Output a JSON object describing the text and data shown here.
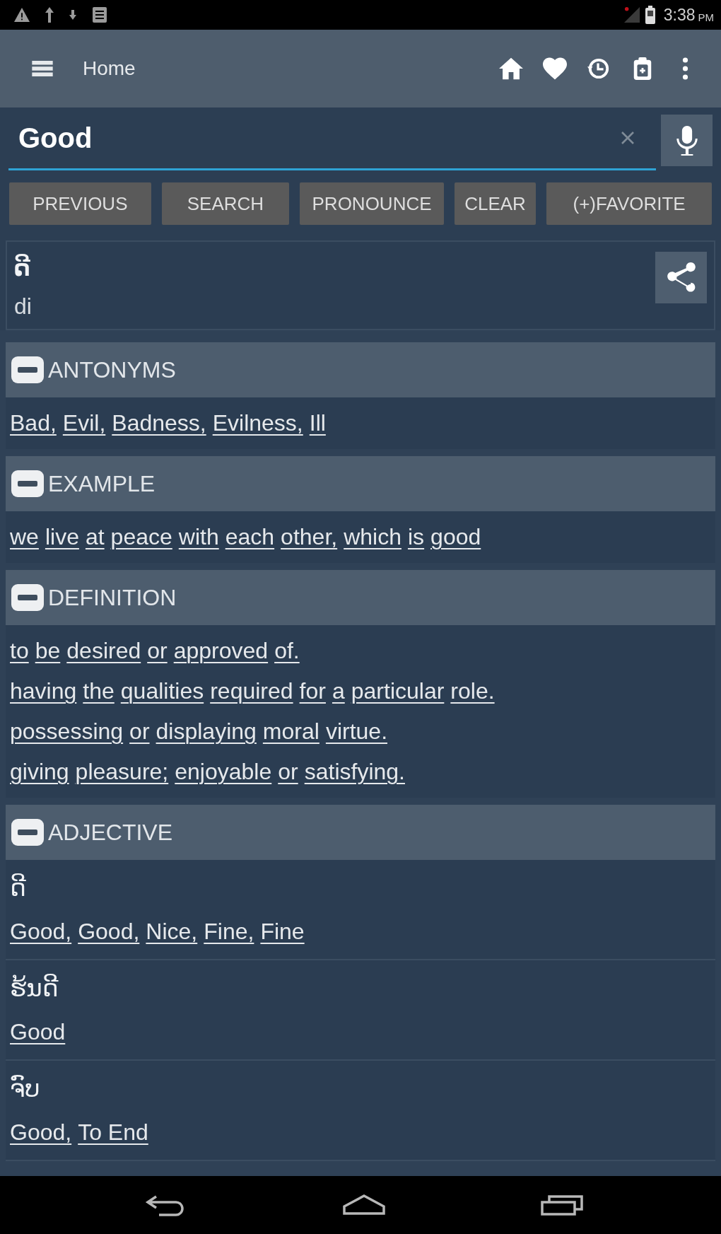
{
  "status_bar": {
    "time": "3:38",
    "period": "PM"
  },
  "app_bar": {
    "title": "Home"
  },
  "search": {
    "value": "Good"
  },
  "buttons": [
    "PREVIOUS",
    "SEARCH",
    "PRONOUNCE",
    "CLEAR",
    "(+)FAVORITE"
  ],
  "entry": {
    "word": "ດີ",
    "romanization": "di"
  },
  "sections": [
    {
      "title": "ANTONYMS",
      "expanded": true,
      "kind": "links",
      "lines": [
        [
          "Bad,",
          "Evil,",
          "Badness,",
          "Evilness,",
          "Ill"
        ]
      ]
    },
    {
      "title": "EXAMPLE",
      "expanded": true,
      "kind": "links",
      "lines": [
        [
          "we",
          "live",
          "at",
          "peace",
          "with",
          "each",
          "other,",
          "which",
          "is",
          "good"
        ]
      ]
    },
    {
      "title": "DEFINITION",
      "expanded": true,
      "kind": "links",
      "lines": [
        [
          "to",
          "be",
          "desired",
          "or",
          "approved",
          "of."
        ],
        [
          "having",
          "the",
          "qualities",
          "required",
          "for",
          "a",
          "particular",
          "role."
        ],
        [
          "possessing",
          "or",
          "displaying",
          "moral",
          "virtue."
        ],
        [
          "giving",
          "pleasure;",
          "enjoyable",
          "or",
          "satisfying."
        ]
      ]
    },
    {
      "title": "ADJECTIVE",
      "expanded": true,
      "kind": "entries",
      "entries": [
        {
          "word": "ດີ",
          "meanings": [
            "Good,",
            "Good,",
            "Nice,",
            "Fine,",
            "Fine"
          ]
        },
        {
          "word": "ຮ້ນດີ",
          "meanings": [
            "Good"
          ]
        },
        {
          "word": "ຈົບ",
          "meanings": [
            "Good,",
            "To End"
          ]
        }
      ]
    }
  ]
}
